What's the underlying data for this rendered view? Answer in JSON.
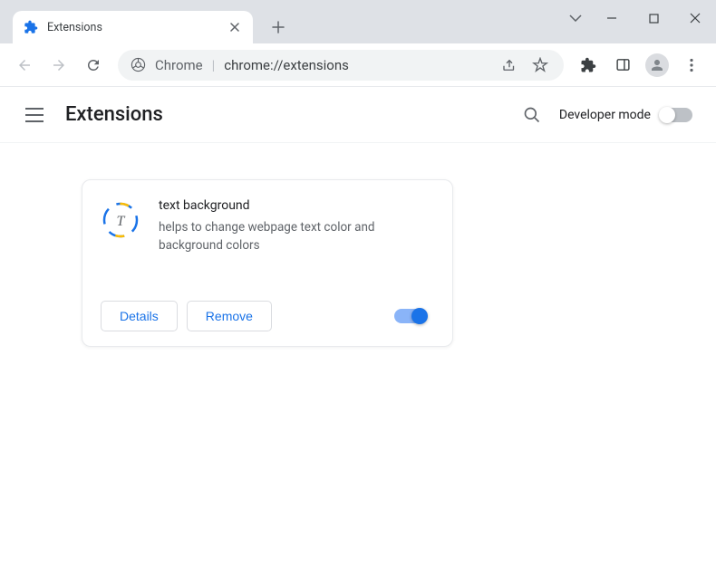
{
  "window": {
    "tab_title": "Extensions"
  },
  "addressbar": {
    "prefix": "Chrome",
    "url": "chrome://extensions"
  },
  "header": {
    "title": "Extensions",
    "dev_mode_label": "Developer mode",
    "dev_mode_on": false
  },
  "extension": {
    "name": "text background",
    "description": "helps to change webpage text color and background colors",
    "details_label": "Details",
    "remove_label": "Remove",
    "enabled": true
  }
}
